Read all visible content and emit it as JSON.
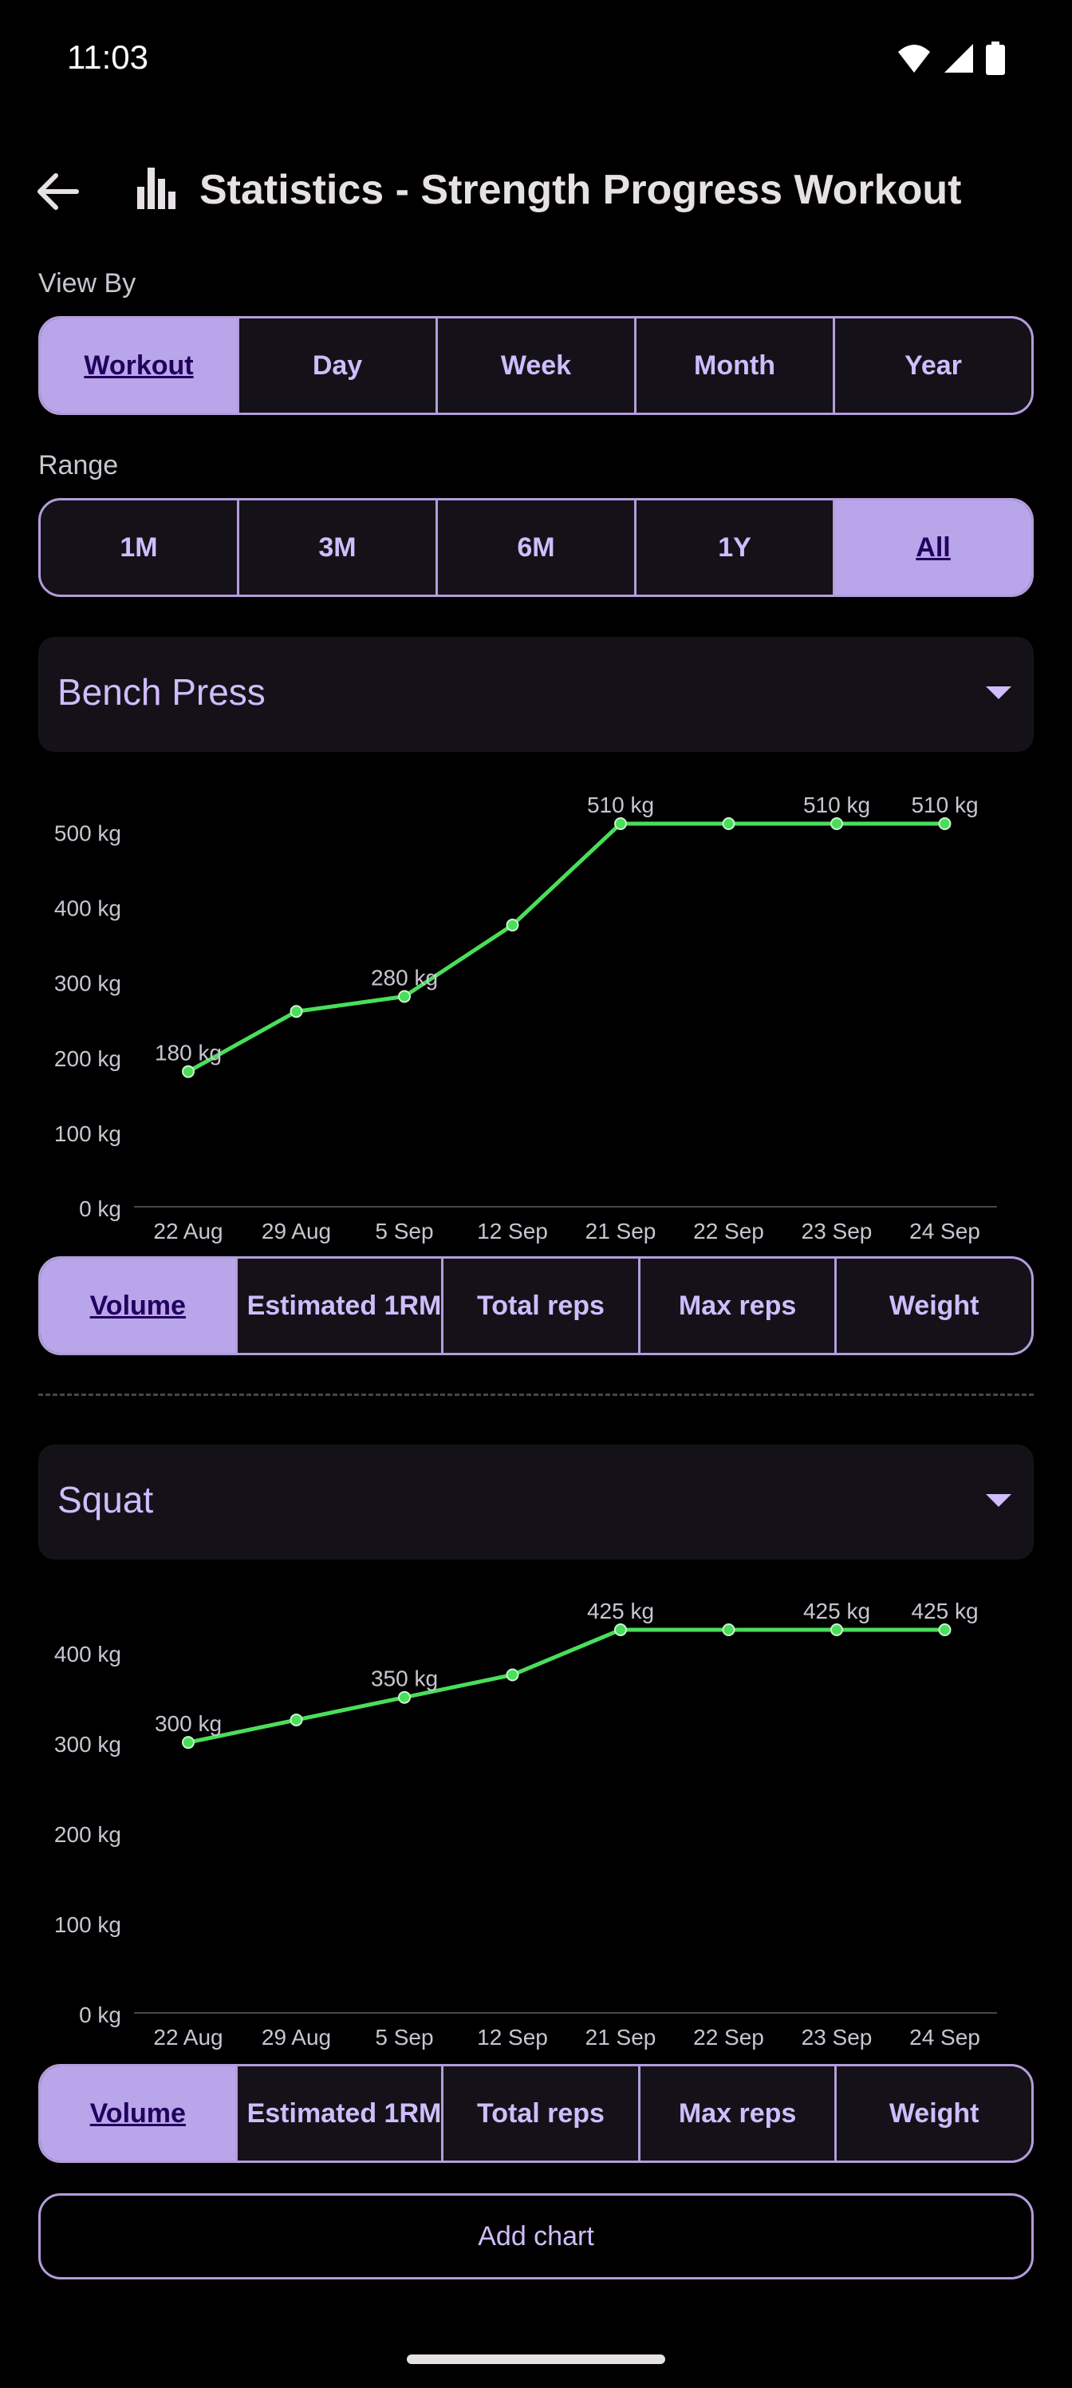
{
  "status_bar": {
    "time": "11:03"
  },
  "app_bar": {
    "title": "Statistics - Strength Progress Workout"
  },
  "view_by": {
    "label": "View By",
    "options": [
      "Workout",
      "Day",
      "Week",
      "Month",
      "Year"
    ],
    "selected": "Workout"
  },
  "range": {
    "label": "Range",
    "options": [
      "1M",
      "3M",
      "6M",
      "1Y",
      "All"
    ],
    "selected": "All"
  },
  "metric_options": [
    "Volume",
    "Estimated 1RM",
    "Total reps",
    "Max reps",
    "Weight"
  ],
  "exercises": [
    {
      "name": "Bench Press",
      "selected_metric": "Volume"
    },
    {
      "name": "Squat",
      "selected_metric": "Volume"
    }
  ],
  "add_chart_label": "Add chart",
  "colors": {
    "accent": "#b9a6ea",
    "line": "#4ade5a",
    "surface": "#141218"
  },
  "chart_data": [
    {
      "type": "line",
      "title": "Bench Press",
      "x": [
        "22 Aug",
        "29 Aug",
        "5 Sep",
        "12 Sep",
        "21 Sep",
        "22 Sep",
        "23 Sep",
        "24 Sep"
      ],
      "values": [
        180,
        260,
        280,
        375,
        510,
        510,
        510,
        510
      ],
      "data_labels": [
        {
          "index": 0,
          "text": "180 kg"
        },
        {
          "index": 2,
          "text": "280 kg"
        },
        {
          "index": 4,
          "text": "510 kg"
        },
        {
          "index": 6,
          "text": "510 kg"
        },
        {
          "index": 7,
          "text": "510 kg"
        }
      ],
      "y_ticks": [
        "0 kg",
        "100 kg",
        "200 kg",
        "300 kg",
        "400 kg",
        "500 kg"
      ],
      "y_tick_values": [
        0,
        100,
        200,
        300,
        400,
        500
      ],
      "ylim": [
        0,
        510
      ],
      "grid": false
    },
    {
      "type": "line",
      "title": "Squat",
      "x": [
        "22 Aug",
        "29 Aug",
        "5 Sep",
        "12 Sep",
        "21 Sep",
        "22 Sep",
        "23 Sep",
        "24 Sep"
      ],
      "values": [
        300,
        325,
        350,
        375,
        425,
        425,
        425,
        425
      ],
      "data_labels": [
        {
          "index": 0,
          "text": "300 kg"
        },
        {
          "index": 2,
          "text": "350 kg"
        },
        {
          "index": 4,
          "text": "425 kg"
        },
        {
          "index": 6,
          "text": "425 kg"
        },
        {
          "index": 7,
          "text": "425 kg"
        }
      ],
      "y_ticks": [
        "0 kg",
        "100 kg",
        "200 kg",
        "300 kg",
        "400 kg"
      ],
      "y_tick_values": [
        0,
        100,
        200,
        300,
        400
      ],
      "ylim": [
        0,
        425
      ],
      "grid": false
    }
  ]
}
